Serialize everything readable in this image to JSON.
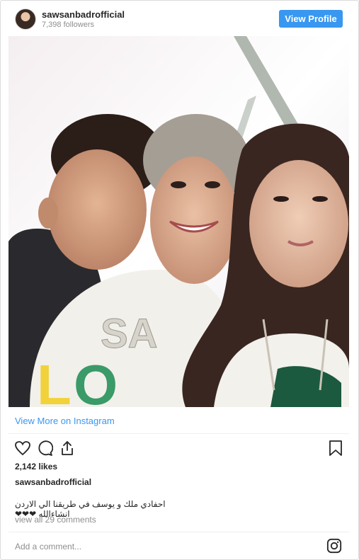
{
  "header": {
    "username": "sawsanbadrofficial",
    "followers": "7,398 followers",
    "view_profile_label": "View Profile"
  },
  "view_more_label": "View More on Instagram",
  "actions": {
    "like_icon": "heart-icon",
    "comment_icon": "comment-icon",
    "share_icon": "share-icon",
    "save_icon": "bookmark-icon"
  },
  "likes": "2,142 likes",
  "caption": {
    "username": "sawsanbadrofficial",
    "text": "احفادي ملك و يوسف في طريقنا الي الاردن انشاءالله ❤❤❤"
  },
  "comments_link": "view all 29 comments",
  "add_comment_placeholder": "Add a comment...",
  "colors": {
    "accent": "#3897f0",
    "muted": "#8e8e8e",
    "text": "#262626"
  }
}
